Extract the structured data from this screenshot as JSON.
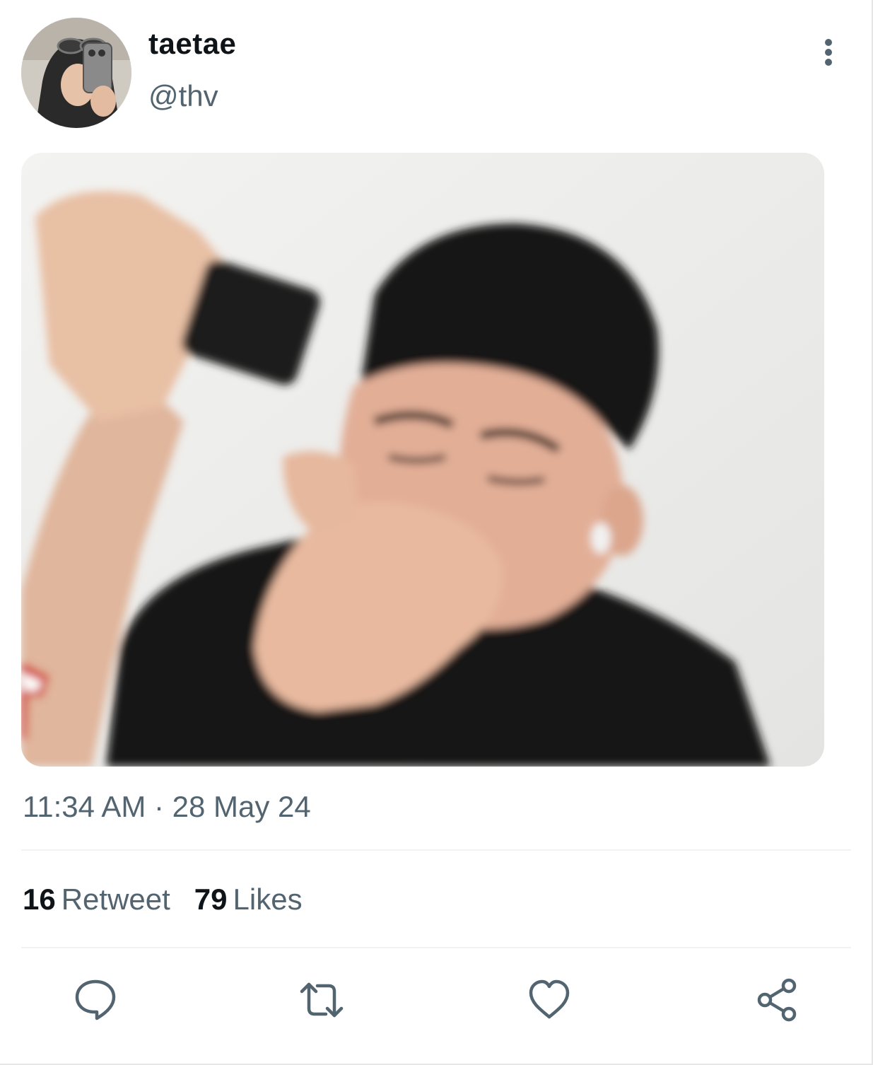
{
  "tweet": {
    "display_name": "taetae",
    "handle": "@thv",
    "timestamp": "11:34 AM · 28 May 24",
    "retweet_count": "16",
    "retweet_label": "Retweet",
    "likes_count": "79",
    "likes_label": "Likes"
  },
  "icons": {
    "more": "more-vertical-icon",
    "reply": "reply-icon",
    "retweet": "retweet-icon",
    "like": "heart-icon",
    "share": "share-icon"
  },
  "colors": {
    "text_primary": "#0f1419",
    "text_secondary": "#536471",
    "divider": "#eff3f4"
  }
}
